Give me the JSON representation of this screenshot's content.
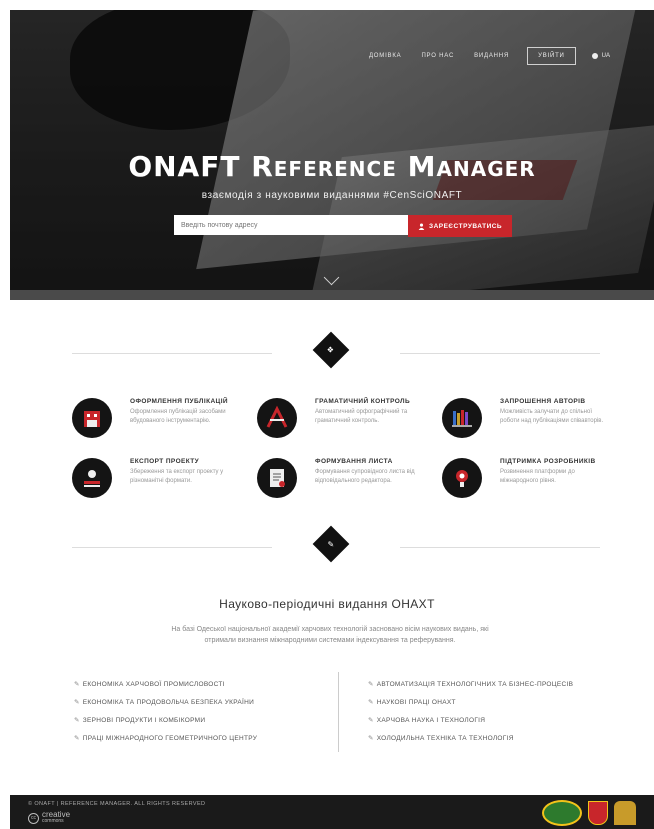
{
  "nav": {
    "links": [
      "Домівка",
      "Про нас",
      "Видання"
    ],
    "login_label": "Увійти",
    "lang_label": "UA"
  },
  "hero": {
    "title": "ONAFT Reference Manager",
    "subtitle": "взаємодія з науковими виданнями #CenSciONAFT",
    "email_placeholder": "Введіть почтову адресу",
    "signup_label": "ЗАРЕЄСТРУВАТИСЬ"
  },
  "features": [
    {
      "title": "Оформлення публікацій",
      "desc": "Оформлення публікацій засобами вбудованого інструментарію.",
      "icon": "building-icon"
    },
    {
      "title": "Граматичний контроль",
      "desc": "Автоматичний орфографічний та граматичний контроль.",
      "icon": "pen-tool-icon"
    },
    {
      "title": "Запрошення авторів",
      "desc": "Можливість залучати до спільної роботи над публікаціями співавторів.",
      "icon": "bookshelf-icon"
    },
    {
      "title": "Експорт проекту",
      "desc": "Збереження та експорт проекту у різноманітні формати.",
      "icon": "export-icon"
    },
    {
      "title": "Формування листа",
      "desc": "Формування супровідного листа від відповідального редактора.",
      "icon": "document-icon"
    },
    {
      "title": "Підтримка розробників",
      "desc": "Розвинення платформи до міжнародного рівня.",
      "icon": "lightbulb-icon"
    }
  ],
  "journals": {
    "title": "Науково-періодичні видання ОНАХТ",
    "desc": "На базі Одеської національної академії харчових технологій засновано вісім наукових видань, які отримали визнання міжнародними системами індексування та реферування.",
    "left": [
      "Економіка харчової промисловості",
      "Економіка та продовольча безпека України",
      "Зернові продукти і комбікорми",
      "Праці міжнародного геометричного центру"
    ],
    "right": [
      "Автоматизація технологічних та бізнес-процесів",
      "Наукові праці ОНАХТ",
      "Харчова наука і технологія",
      "Холодильна техніка та технологія"
    ]
  },
  "footer": {
    "copyright": "© ONAFT | Reference Manager. All rights reserved",
    "cc_label": "creative",
    "cc_sub": "commons"
  },
  "colors": {
    "accent": "#c8262b",
    "dark": "#141414",
    "footer": "#1a1a1a"
  }
}
